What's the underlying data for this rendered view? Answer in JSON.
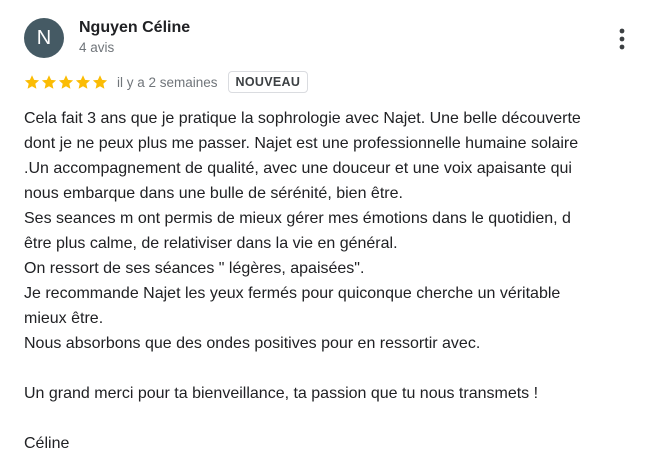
{
  "review": {
    "author": {
      "initial": "N",
      "name": "Nguyen Céline",
      "review_count": "4 avis",
      "avatar_color": "#455a64"
    },
    "rating": {
      "stars": 5,
      "max": 5,
      "star_color": "#fbbc04"
    },
    "date": "il y a 2 semaines",
    "badge": "NOUVEAU",
    "more_icon": "more-vert-icon",
    "text_lines": [
      "Cela fait 3 ans que je pratique la sophrologie avec Najet. Une belle découverte",
      "dont je ne peux plus me passer. Najet est une professionnelle humaine solaire",
      ".Un accompagnement de qualité, avec une douceur et une voix apaisante qui",
      "nous embarque dans une bulle de sérénité, bien être.",
      "Ses seances m ont permis de mieux gérer mes émotions dans le quotidien, d",
      "être plus calme, de relativiser dans la vie en général.",
      "On ressort de ses séances \" légères, apaisées\".",
      "Je recommande Najet les yeux fermés pour quiconque cherche un véritable",
      "mieux être.",
      "Nous absorbons que des ondes positives pour en ressortir avec.",
      "",
      "Un grand merci pour ta bienveillance, ta passion que tu nous transmets !",
      "",
      "Céline"
    ]
  }
}
